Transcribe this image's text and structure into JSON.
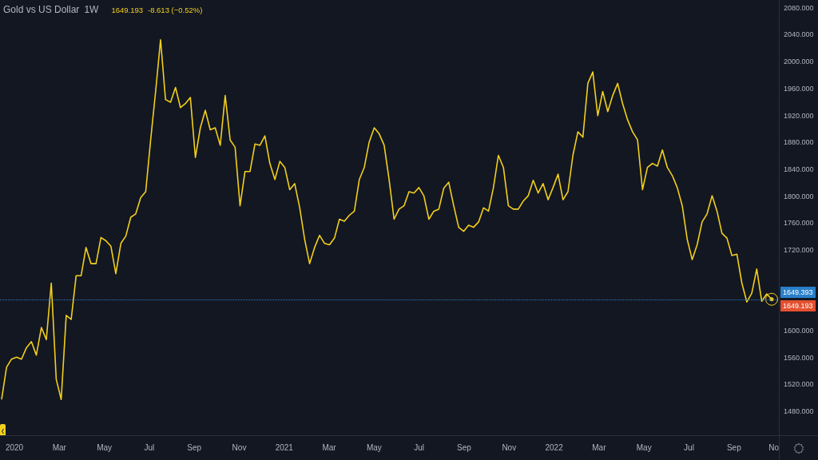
{
  "legend": {
    "interval": "1W",
    "last": "1649.193",
    "change": "-8.613 (−0.52%)"
  },
  "chart_data": {
    "type": "line",
    "series": [
      {
        "name": "Gold vs US Dollar",
        "color": "#f2cf1d",
        "values": [
          1500,
          1548,
          1560,
          1563,
          1560,
          1577,
          1586,
          1566,
          1607,
          1589,
          1673,
          1530,
          1500,
          1625,
          1619,
          1684,
          1684,
          1726,
          1702,
          1702,
          1741,
          1736,
          1728,
          1687,
          1732,
          1743,
          1771,
          1776,
          1800,
          1809,
          1886,
          1958,
          2035,
          1946,
          1942,
          1964,
          1934,
          1940,
          1949,
          1860,
          1904,
          1930,
          1901,
          1904,
          1878,
          1952,
          1886,
          1875,
          1788,
          1839,
          1839,
          1880,
          1878,
          1892,
          1851,
          1827,
          1854,
          1845,
          1812,
          1821,
          1785,
          1738,
          1702,
          1726,
          1744,
          1732,
          1730,
          1740,
          1768,
          1765,
          1774,
          1780,
          1827,
          1845,
          1883,
          1904,
          1895,
          1878,
          1827,
          1768,
          1783,
          1788,
          1809,
          1807,
          1815,
          1803,
          1768,
          1780,
          1783,
          1814,
          1823,
          1788,
          1756,
          1750,
          1759,
          1756,
          1764,
          1785,
          1780,
          1815,
          1863,
          1845,
          1788,
          1783,
          1783,
          1795,
          1803,
          1826,
          1807,
          1821,
          1797,
          1815,
          1835,
          1797,
          1809,
          1863,
          1898,
          1890,
          1970,
          1987,
          1922,
          1958,
          1928,
          1952,
          1970,
          1940,
          1916,
          1898,
          1886,
          1812,
          1845,
          1851,
          1847,
          1871,
          1845,
          1833,
          1815,
          1788,
          1738,
          1708,
          1730,
          1764,
          1776,
          1803,
          1780,
          1747,
          1740,
          1714,
          1716,
          1673,
          1645,
          1658,
          1694,
          1646,
          1657,
          1649
        ]
      }
    ],
    "ylim": [
      1410,
      2094
    ],
    "yticks": [
      {
        "value": 2080,
        "label": "2080.000"
      },
      {
        "value": 2040,
        "label": "2040.000"
      },
      {
        "value": 2000,
        "label": "2000.000"
      },
      {
        "value": 1960,
        "label": "1960.000"
      },
      {
        "value": 1920,
        "label": "1920.000"
      },
      {
        "value": 1880,
        "label": "1880.000"
      },
      {
        "value": 1840,
        "label": "1840.000"
      },
      {
        "value": 1800,
        "label": "1800.000"
      },
      {
        "value": 1760,
        "label": "1760.000"
      },
      {
        "value": 1720,
        "label": "1720.000"
      },
      {
        "value": 1600,
        "label": "1600.000"
      },
      {
        "value": 1560,
        "label": "1560.000"
      },
      {
        "value": 1520,
        "label": "1520.000"
      },
      {
        "value": 1480,
        "label": "1480.000"
      }
    ]
  },
  "time_axis": [
    "2020",
    "Mar",
    "May",
    "Jul",
    "Sep",
    "Nov",
    "2021",
    "Mar",
    "May",
    "Jul",
    "Sep",
    "Nov",
    "2022",
    "Mar",
    "May",
    "Jul",
    "Sep",
    "No"
  ],
  "price_badges": [
    {
      "label": "1649.393",
      "color": "#2a7fc9"
    },
    {
      "label": "1649.193",
      "color": "#e4502f"
    }
  ]
}
